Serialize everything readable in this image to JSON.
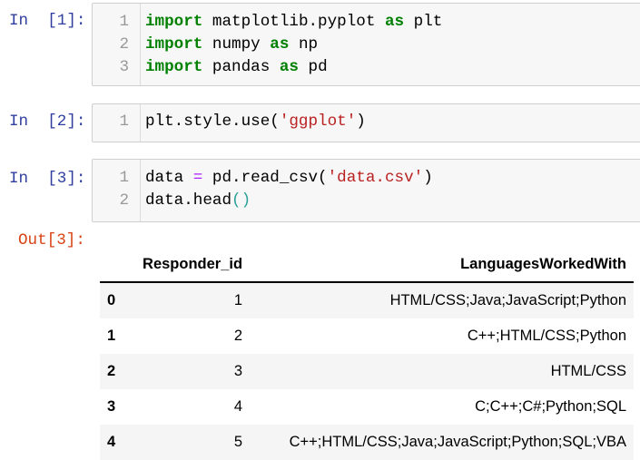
{
  "cells": [
    {
      "prompt": "In  [1]:",
      "lines": [
        [
          {
            "t": "import",
            "c": "kw"
          },
          {
            "t": " matplotlib.pyplot ",
            "c": ""
          },
          {
            "t": "as",
            "c": "kw"
          },
          {
            "t": " plt",
            "c": ""
          }
        ],
        [
          {
            "t": "import",
            "c": "kw"
          },
          {
            "t": " numpy ",
            "c": ""
          },
          {
            "t": "as",
            "c": "kw"
          },
          {
            "t": " np",
            "c": ""
          }
        ],
        [
          {
            "t": "import",
            "c": "kw"
          },
          {
            "t": " pandas ",
            "c": ""
          },
          {
            "t": "as",
            "c": "kw"
          },
          {
            "t": " pd",
            "c": ""
          }
        ]
      ]
    },
    {
      "prompt": "In  [2]:",
      "lines": [
        [
          {
            "t": "plt.style.use(",
            "c": ""
          },
          {
            "t": "'ggplot'",
            "c": "str"
          },
          {
            "t": ")",
            "c": ""
          }
        ]
      ]
    },
    {
      "prompt": "In  [3]:",
      "lines": [
        [
          {
            "t": "data ",
            "c": ""
          },
          {
            "t": "=",
            "c": "op"
          },
          {
            "t": " pd.read_csv(",
            "c": ""
          },
          {
            "t": "'data.csv'",
            "c": "str"
          },
          {
            "t": ")",
            "c": ""
          }
        ],
        [
          {
            "t": "data.head",
            "c": ""
          },
          {
            "t": "()",
            "c": "par"
          }
        ]
      ]
    }
  ],
  "output": {
    "prompt": "Out[3]:",
    "columns": [
      "",
      "Responder_id",
      "LanguagesWorkedWith"
    ],
    "rows": [
      [
        "0",
        "1",
        "HTML/CSS;Java;JavaScript;Python"
      ],
      [
        "1",
        "2",
        "C++;HTML/CSS;Python"
      ],
      [
        "2",
        "3",
        "HTML/CSS"
      ],
      [
        "3",
        "4",
        "C;C++;C#;Python;SQL"
      ],
      [
        "4",
        "5",
        "C++;HTML/CSS;Java;JavaScript;Python;SQL;VBA"
      ]
    ]
  }
}
